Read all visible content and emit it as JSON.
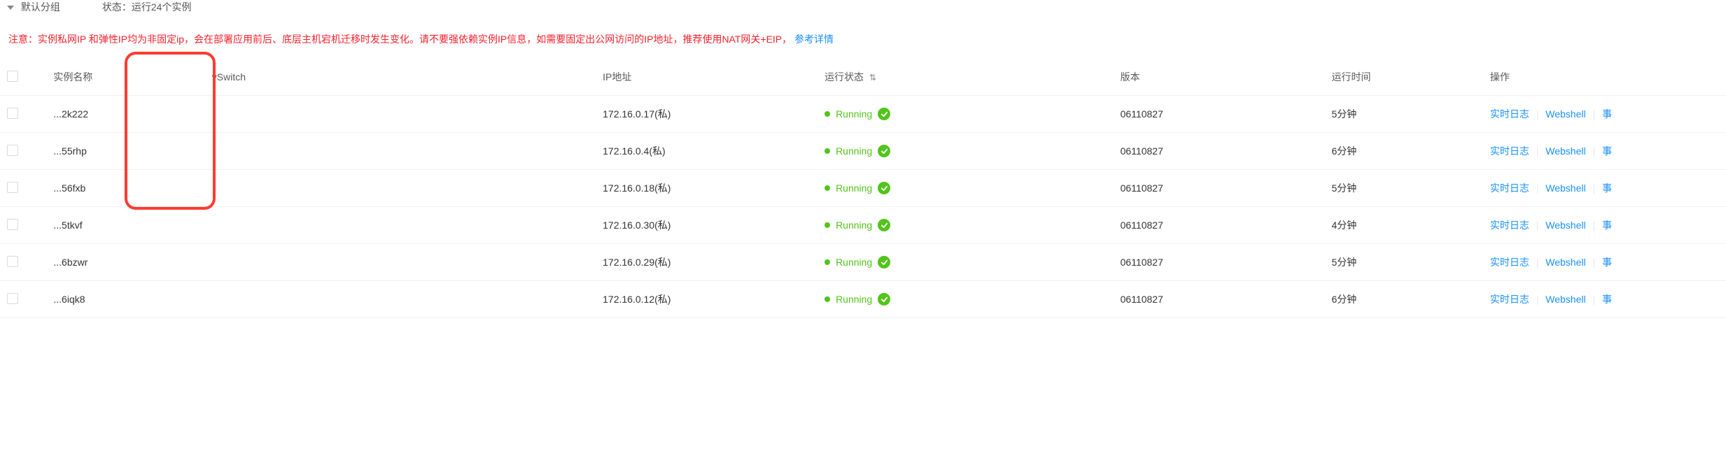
{
  "header": {
    "group_label": "默认分组",
    "status_prefix": "状态：",
    "status_value": "运行24个实例"
  },
  "notice": {
    "text": "注意：实例私网IP 和弹性IP均为非固定ip，会在部署应用前后、底层主机宕机迁移时发生变化。请不要强依赖实例IP信息，如需要固定出公网访问的IP地址，推荐使用NAT网关+EIP，",
    "link_text": "参考详情"
  },
  "columns": {
    "instance_name": "实例名称",
    "vswitch": "vSwitch",
    "ip": "IP地址",
    "status": "运行状态",
    "version": "版本",
    "runtime": "运行时间",
    "actions": "操作"
  },
  "actions": {
    "realtime_log": "实时日志",
    "webshell": "Webshell",
    "events": "事"
  },
  "status_values": {
    "running": "Running"
  },
  "rows": [
    {
      "name": "...2k222",
      "vswitch": "",
      "ip": "172.16.0.17(私)",
      "status": "Running",
      "version": "06110827",
      "runtime": "5分钟"
    },
    {
      "name": "...55rhp",
      "vswitch": "",
      "ip": "172.16.0.4(私)",
      "status": "Running",
      "version": "06110827",
      "runtime": "6分钟"
    },
    {
      "name": "...56fxb",
      "vswitch": "",
      "ip": "172.16.0.18(私)",
      "status": "Running",
      "version": "06110827",
      "runtime": "5分钟"
    },
    {
      "name": "...5tkvf",
      "vswitch": "",
      "ip": "172.16.0.30(私)",
      "status": "Running",
      "version": "06110827",
      "runtime": "4分钟"
    },
    {
      "name": "...6bzwr",
      "vswitch": "",
      "ip": "172.16.0.29(私)",
      "status": "Running",
      "version": "06110827",
      "runtime": "5分钟"
    },
    {
      "name": "...6iqk8",
      "vswitch": "",
      "ip": "172.16.0.12(私)",
      "status": "Running",
      "version": "06110827",
      "runtime": "6分钟"
    }
  ],
  "highlight": {
    "column": "vswitch"
  }
}
